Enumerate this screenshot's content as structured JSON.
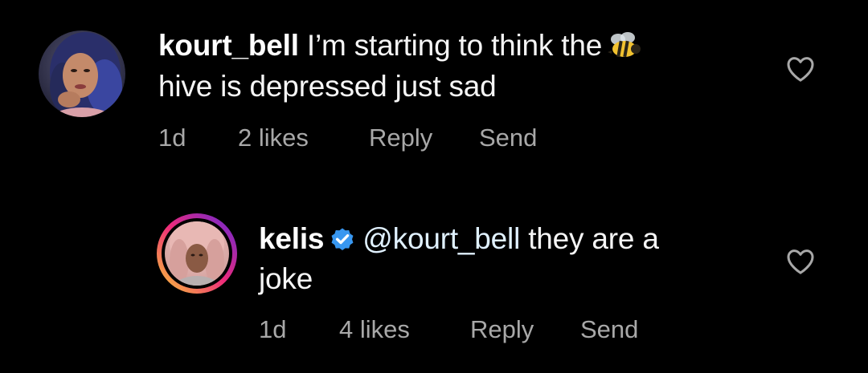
{
  "comments": [
    {
      "username": "kourt_bell",
      "text_before_emoji": "I’m starting to think the",
      "emoji": "bee-icon",
      "text_after_emoji": "hive is depressed just sad",
      "time": "1d",
      "likes": "2 likes",
      "reply_label": "Reply",
      "send_label": "Send"
    },
    {
      "username": "kelis",
      "verified": true,
      "mention": "@kourt_bell",
      "text": "they are a",
      "text_line2": "joke",
      "time": "1d",
      "likes": "4 likes",
      "reply_label": "Reply",
      "send_label": "Send"
    }
  ],
  "colors": {
    "background": "#000000",
    "text": "#f5f5f5",
    "meta": "#a8a8a8",
    "verified": "#3897f0",
    "story_ring_start": "#f9ce34",
    "story_ring_mid": "#ee2a7b",
    "story_ring_end": "#6228d7"
  }
}
